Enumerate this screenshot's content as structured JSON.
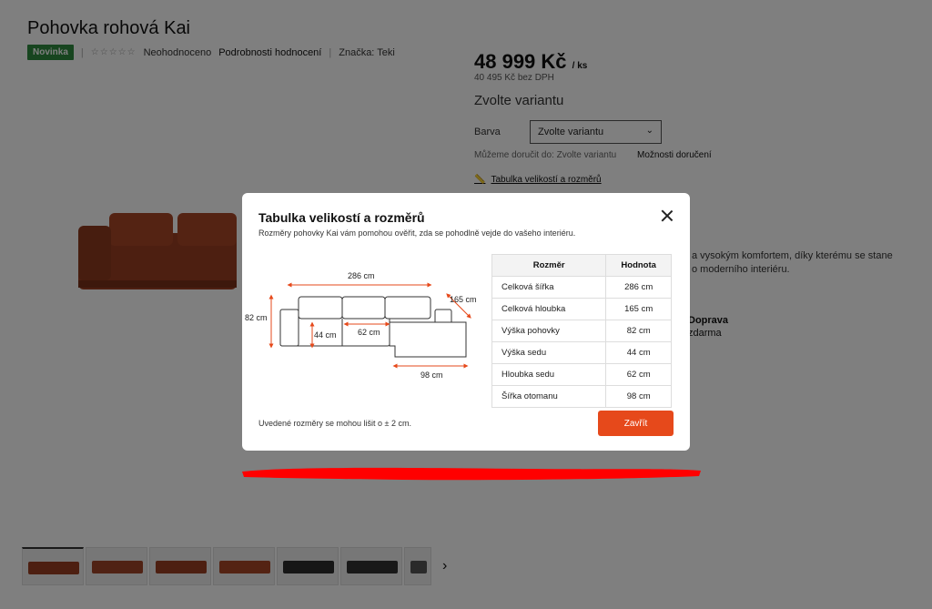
{
  "product": {
    "title": "Pohovka rohová Kai",
    "badge": "Novinka",
    "stars": "☆☆☆☆☆",
    "rating_text": "Neohodnoceno",
    "reviews_link": "Podrobnosti hodnocení",
    "brand": "Značka: Teki",
    "price": "48 999 Kč",
    "price_unit": "/ ks",
    "price_net": "40 495 Kč bez DPH",
    "variant_heading": "Zvolte variantu",
    "color_label": "Barva",
    "color_select": "Zvolte variantu",
    "delivery_text": "Můžeme doručit do: Zvolte variantu",
    "delivery_options": "Možnosti doručení",
    "size_table_link": "Tabulka velikostí a rozměrů",
    "description": "a vysokým komfortem, díky kterému se stane\no moderního interiéru.",
    "transport_title": "Doprava",
    "transport_value": "zdarma"
  },
  "modal": {
    "title": "Tabulka velikostí a rozměrů",
    "subtitle": "Rozměry pohovky Kai vám pomohou ověřit, zda se pohodlně vejde do vašeho interiéru.",
    "diagram_labels": {
      "width": "286 cm",
      "depth": "165 cm",
      "height": "82 cm",
      "seat_height": "44 cm",
      "seat_depth": "62 cm",
      "ottoman": "98 cm"
    },
    "table_headers": [
      "Rozměr",
      "Hodnota"
    ],
    "rows": [
      {
        "name": "Celková šířka",
        "value": "286 cm"
      },
      {
        "name": "Celková hloubka",
        "value": "165 cm"
      },
      {
        "name": "Výška pohovky",
        "value": "82 cm"
      },
      {
        "name": "Výška sedu",
        "value": "44 cm"
      },
      {
        "name": "Hloubka sedu",
        "value": "62 cm"
      },
      {
        "name": "Šířka otomanu",
        "value": "98 cm"
      }
    ],
    "note": "Uvedené rozměry se mohou lišit o ± 2 cm.",
    "close_label": "Zavřít"
  },
  "colors": {
    "accent": "#e6491b",
    "badge": "#2e8b3e",
    "sofa": "#9a3f22",
    "sofa_dark": "#2d2d2d",
    "annotation_red": "#ff0000"
  }
}
